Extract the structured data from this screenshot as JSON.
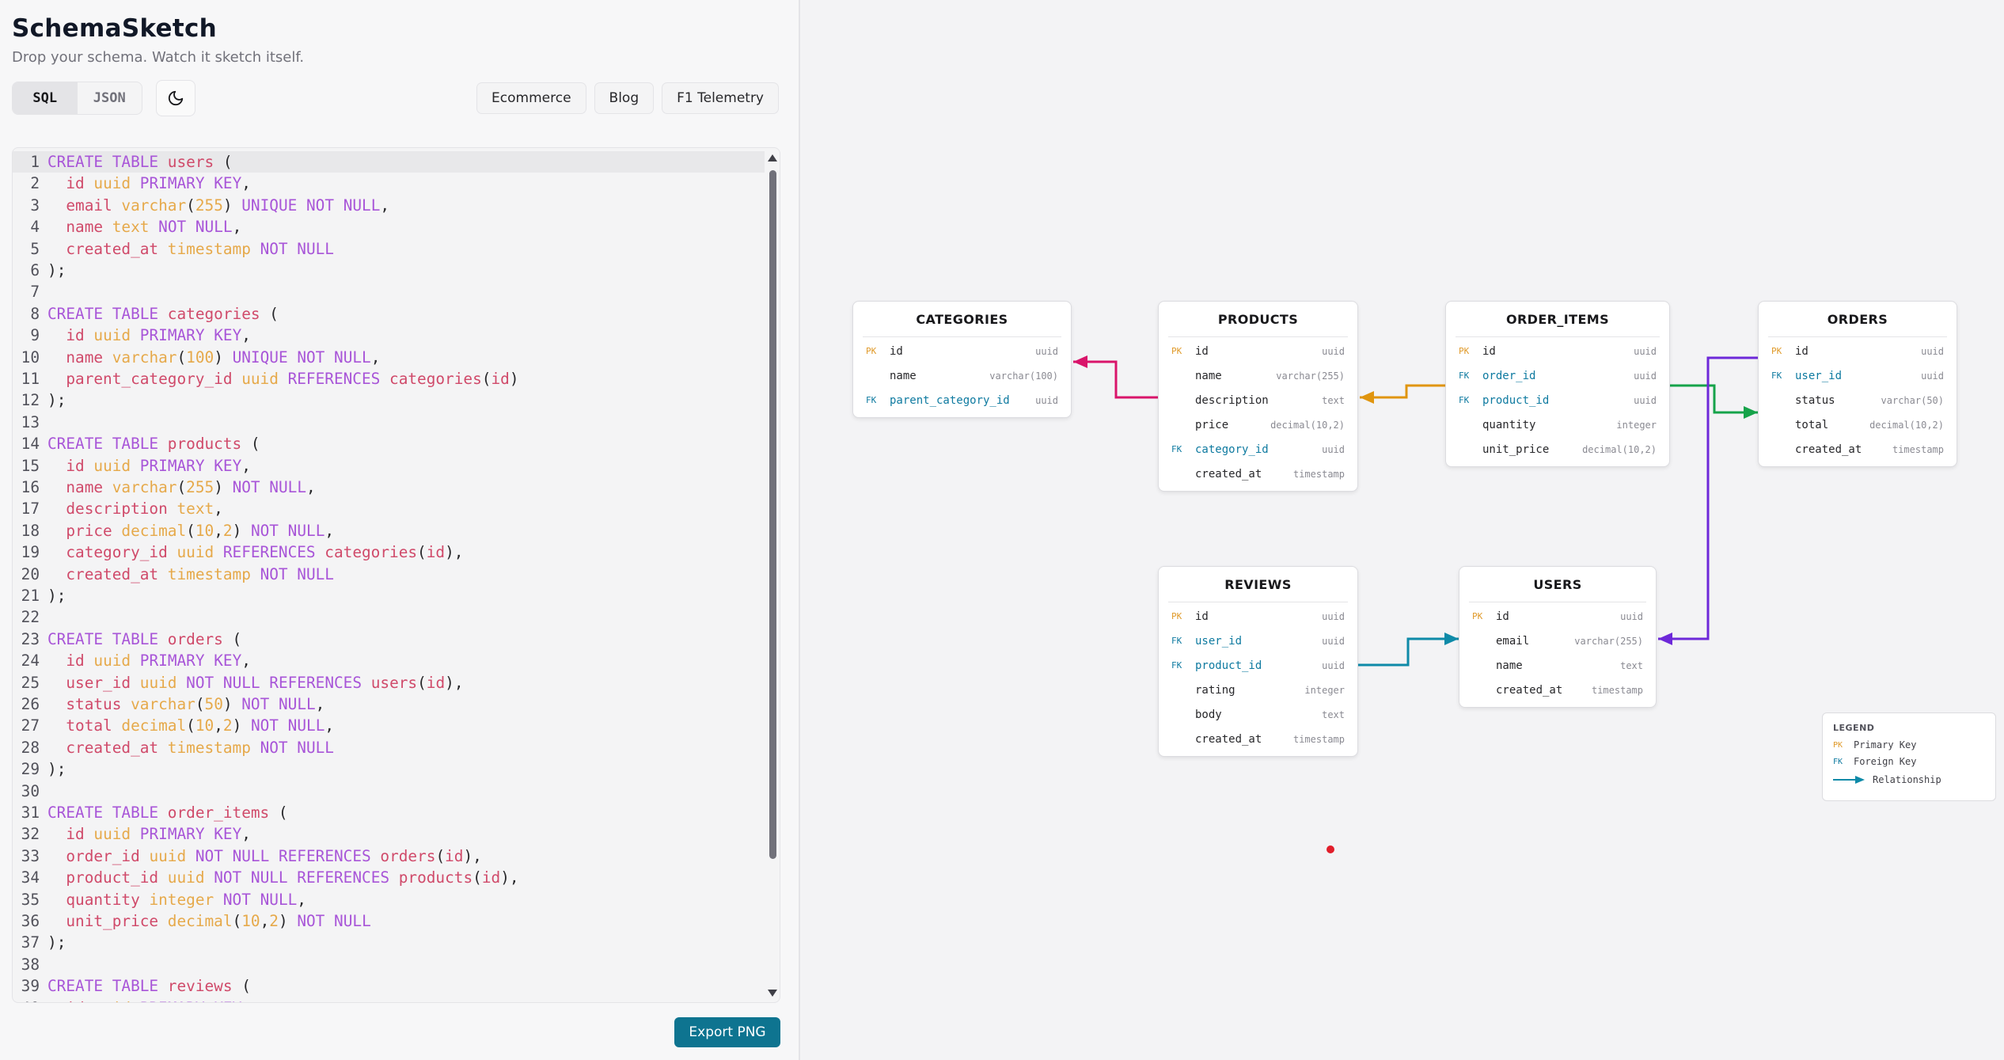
{
  "app": {
    "title": "SchemaSketch",
    "subtitle": "Drop your schema. Watch it sketch itself."
  },
  "mode_toggle": {
    "sql": "SQL",
    "json": "JSON",
    "active": "SQL"
  },
  "theme_button_icon": "moon-icon",
  "examples": [
    "Ecommerce",
    "Blog",
    "F1 Telemetry"
  ],
  "export_label": "Export PNG",
  "editor": {
    "lines": [
      "CREATE TABLE users (",
      "  id uuid PRIMARY KEY,",
      "  email varchar(255) UNIQUE NOT NULL,",
      "  name text NOT NULL,",
      "  created_at timestamp NOT NULL",
      ");",
      "",
      "CREATE TABLE categories (",
      "  id uuid PRIMARY KEY,",
      "  name varchar(100) UNIQUE NOT NULL,",
      "  parent_category_id uuid REFERENCES categories(id)",
      ");",
      "",
      "CREATE TABLE products (",
      "  id uuid PRIMARY KEY,",
      "  name varchar(255) NOT NULL,",
      "  description text,",
      "  price decimal(10,2) NOT NULL,",
      "  category_id uuid REFERENCES categories(id),",
      "  created_at timestamp NOT NULL",
      ");",
      "",
      "CREATE TABLE orders (",
      "  id uuid PRIMARY KEY,",
      "  user_id uuid NOT NULL REFERENCES users(id),",
      "  status varchar(50) NOT NULL,",
      "  total decimal(10,2) NOT NULL,",
      "  created_at timestamp NOT NULL",
      ");",
      "",
      "CREATE TABLE order_items (",
      "  id uuid PRIMARY KEY,",
      "  order_id uuid NOT NULL REFERENCES orders(id),",
      "  product_id uuid NOT NULL REFERENCES products(id),",
      "  quantity integer NOT NULL,",
      "  unit_price decimal(10,2) NOT NULL",
      ");",
      "",
      "CREATE TABLE reviews (",
      "  id uuid PRIMARY KEY,"
    ]
  },
  "entities": [
    {
      "id": "categories",
      "title": "CATEGORIES",
      "fields": [
        {
          "key": "PK",
          "name": "id",
          "type": "uuid"
        },
        {
          "key": "",
          "name": "name",
          "type": "varchar(100)"
        },
        {
          "key": "FK",
          "name": "parent_category_id",
          "type": "uuid"
        }
      ]
    },
    {
      "id": "products",
      "title": "PRODUCTS",
      "fields": [
        {
          "key": "PK",
          "name": "id",
          "type": "uuid"
        },
        {
          "key": "",
          "name": "name",
          "type": "varchar(255)"
        },
        {
          "key": "",
          "name": "description",
          "type": "text"
        },
        {
          "key": "",
          "name": "price",
          "type": "decimal(10,2)"
        },
        {
          "key": "FK",
          "name": "category_id",
          "type": "uuid"
        },
        {
          "key": "",
          "name": "created_at",
          "type": "timestamp"
        }
      ]
    },
    {
      "id": "order_items",
      "title": "ORDER_ITEMS",
      "fields": [
        {
          "key": "PK",
          "name": "id",
          "type": "uuid"
        },
        {
          "key": "FK",
          "name": "order_id",
          "type": "uuid"
        },
        {
          "key": "FK",
          "name": "product_id",
          "type": "uuid"
        },
        {
          "key": "",
          "name": "quantity",
          "type": "integer"
        },
        {
          "key": "",
          "name": "unit_price",
          "type": "decimal(10,2)"
        }
      ]
    },
    {
      "id": "orders",
      "title": "ORDERS",
      "fields": [
        {
          "key": "PK",
          "name": "id",
          "type": "uuid"
        },
        {
          "key": "FK",
          "name": "user_id",
          "type": "uuid"
        },
        {
          "key": "",
          "name": "status",
          "type": "varchar(50)"
        },
        {
          "key": "",
          "name": "total",
          "type": "decimal(10,2)"
        },
        {
          "key": "",
          "name": "created_at",
          "type": "timestamp"
        }
      ]
    },
    {
      "id": "reviews",
      "title": "REVIEWS",
      "fields": [
        {
          "key": "PK",
          "name": "id",
          "type": "uuid"
        },
        {
          "key": "FK",
          "name": "user_id",
          "type": "uuid"
        },
        {
          "key": "FK",
          "name": "product_id",
          "type": "uuid"
        },
        {
          "key": "",
          "name": "rating",
          "type": "integer"
        },
        {
          "key": "",
          "name": "body",
          "type": "text"
        },
        {
          "key": "",
          "name": "created_at",
          "type": "timestamp"
        }
      ]
    },
    {
      "id": "users",
      "title": "USERS",
      "fields": [
        {
          "key": "PK",
          "name": "id",
          "type": "uuid"
        },
        {
          "key": "",
          "name": "email",
          "type": "varchar(255)"
        },
        {
          "key": "",
          "name": "name",
          "type": "text"
        },
        {
          "key": "",
          "name": "created_at",
          "type": "timestamp"
        }
      ]
    }
  ],
  "relationships": [
    {
      "from": "products.category_id",
      "to": "categories",
      "color": "#d9146a"
    },
    {
      "from": "order_items.product_id",
      "to": "products",
      "color": "#e0950f"
    },
    {
      "from": "order_items.order_id",
      "to": "orders",
      "color": "#16a34a"
    },
    {
      "from": "orders.user_id",
      "to": "users",
      "color": "#6d28d9"
    },
    {
      "from": "reviews.user_id",
      "to": "users",
      "color": "#0e8aa8"
    }
  ],
  "legend": {
    "title": "LEGEND",
    "pk_badge": "PK",
    "pk_label": "Primary Key",
    "fk_badge": "FK",
    "fk_label": "Foreign Key",
    "rel_label": "Relationship"
  },
  "colors": {
    "accent": "#0e7490",
    "pk": "#e09a2a",
    "fk": "#0e7aa0",
    "marker": "#e11d2a"
  }
}
